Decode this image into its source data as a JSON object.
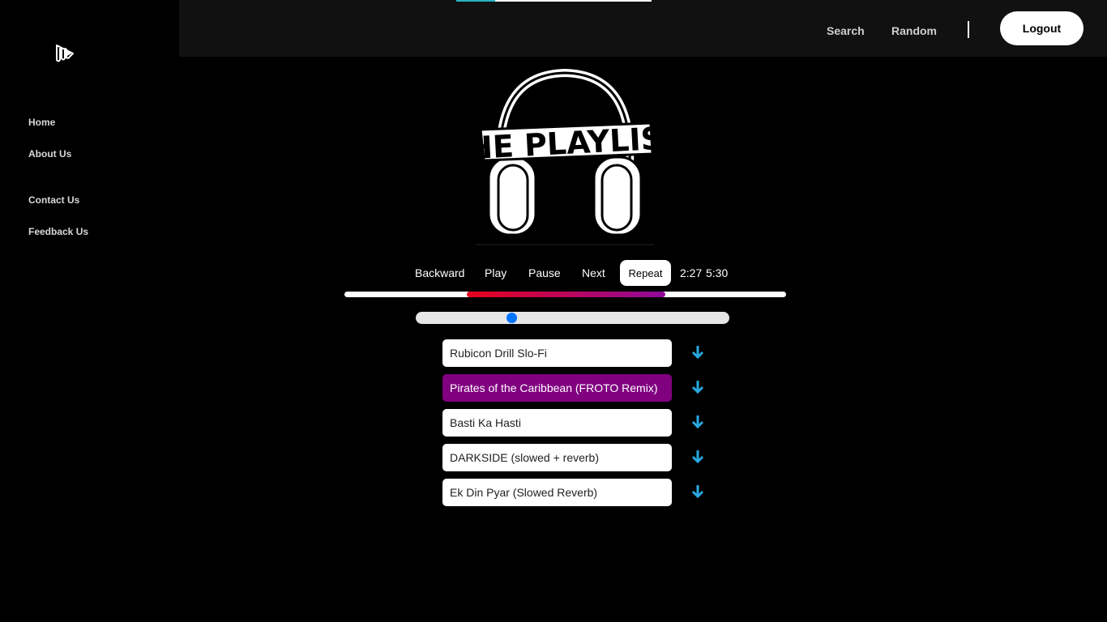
{
  "sidebar": {
    "items": [
      {
        "label": "Home"
      },
      {
        "label": "About Us"
      },
      {
        "label": "Contact Us"
      },
      {
        "label": "Feedback Us"
      }
    ]
  },
  "topbar": {
    "progress_fraction": 0.2,
    "links": [
      {
        "label": "Search"
      },
      {
        "label": "Random"
      }
    ],
    "logout_label": "Logout"
  },
  "album": {
    "logo_text": "THE PLAYLIST"
  },
  "controls": {
    "backward": "Backward",
    "play": "Play",
    "pause": "Pause",
    "next": "Next",
    "repeat": "Repeat",
    "current_time": "2:27",
    "duration": "5:30"
  },
  "seek": {
    "start_fraction": 0.277,
    "end_fraction": 0.727,
    "color_start": "#e8001c",
    "color_end": "#8e0a9a"
  },
  "volume": {
    "level": 0.3
  },
  "colors": {
    "active_song": "#800080",
    "download": "#29a8e0",
    "volume_thumb": "#0075ff"
  },
  "songs": [
    {
      "title": "Rubicon Drill Slo-Fi",
      "active": false
    },
    {
      "title": "Pirates of the Caribbean (FROTO Remix)",
      "active": true
    },
    {
      "title": "Basti Ka Hasti",
      "active": false
    },
    {
      "title": "DARKSIDE (slowed + reverb)",
      "active": false
    },
    {
      "title": "Ek Din Pyar (Slowed Reverb)",
      "active": false
    }
  ]
}
